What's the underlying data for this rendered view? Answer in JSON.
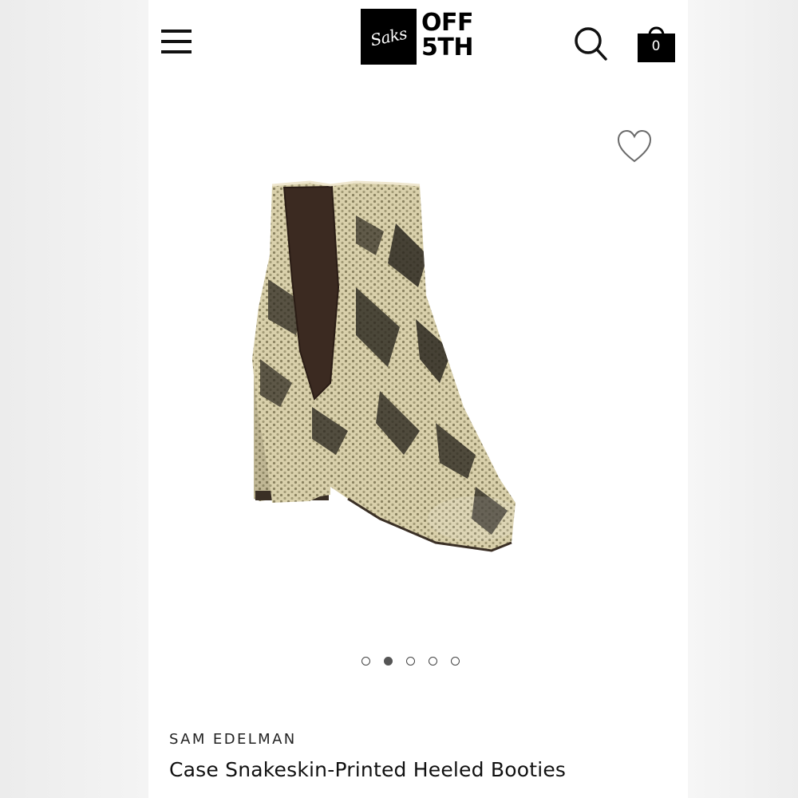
{
  "header": {
    "menu_icon": "hamburger-menu-icon",
    "logo": {
      "script": "Saks",
      "line1": "OFF",
      "line2": "5TH"
    },
    "search_icon": "search-icon",
    "bag_icon": "shopping-bag-icon",
    "bag_count": "0"
  },
  "product": {
    "wishlist_icon": "heart-outline-icon",
    "image_description": "snakeskin-print heeled chelsea bootie",
    "gallery": {
      "total_images": 5,
      "active_index": 1
    },
    "brand": "SAM EDELMAN",
    "title": "Case Snakeskin-Printed Heeled Booties"
  },
  "colors": {
    "text": "#111111",
    "logo_bg": "#000000",
    "snake_base": "#d8cfa8",
    "snake_dark": "#2e2a22",
    "elastic": "#3a2a20"
  }
}
